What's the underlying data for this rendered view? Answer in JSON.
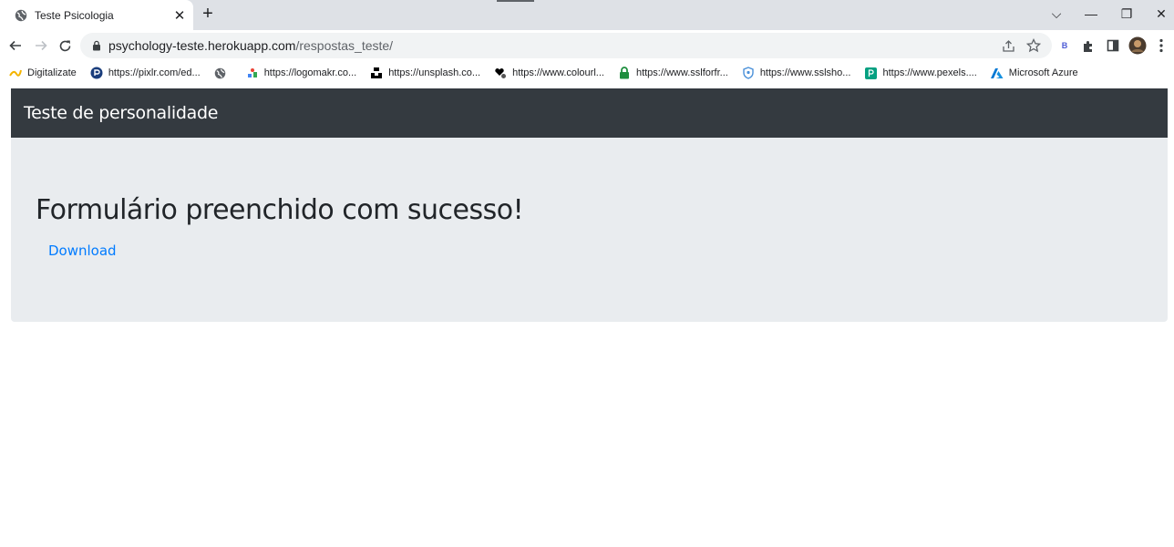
{
  "browser": {
    "tab": {
      "title": "Teste Psicologia",
      "close_glyph": "✕"
    },
    "new_tab_glyph": "+",
    "window_controls": {
      "dropdown": "⌵",
      "minimize": "—",
      "restore": "❐",
      "close": "✕"
    },
    "address": {
      "host": "psychology-teste.herokuapp.com",
      "path": "/respostas_teste/"
    },
    "profile_letter": "B",
    "bookmarks": [
      {
        "label": "Digitalizate",
        "icon": "digitalizate-icon",
        "color": "#f4b400"
      },
      {
        "label": "https://pixlr.com/ed...",
        "icon": "pixlr-icon",
        "color": "#1a3d7c"
      },
      {
        "label": "",
        "icon": "globe-icon",
        "color": "#5f6368"
      },
      {
        "label": "https://logomakr.co...",
        "icon": "logomakr-icon",
        "color": "#4285f4"
      },
      {
        "label": "https://unsplash.co...",
        "icon": "unsplash-icon",
        "color": "#000000"
      },
      {
        "label": "https://www.colourl...",
        "icon": "colourlovers-icon",
        "color": "#000000"
      },
      {
        "label": "https://www.sslforfr...",
        "icon": "lock-green-icon",
        "color": "#1e8e3e"
      },
      {
        "label": "https://www.sslsho...",
        "icon": "shield-icon",
        "color": "#4a90d9"
      },
      {
        "label": "https://www.pexels....",
        "icon": "pexels-icon",
        "color": "#05a081"
      },
      {
        "label": "Microsoft Azure",
        "icon": "azure-icon",
        "color": "#0078d4"
      }
    ]
  },
  "page": {
    "navbar": {
      "brand": "Teste de personalidade"
    },
    "main": {
      "heading": "Formulário preenchido com sucesso!",
      "download_link": "Download"
    }
  },
  "colors": {
    "navbar_bg": "#343a40",
    "jumbotron_bg": "#e9ecef",
    "link": "#007bff"
  }
}
